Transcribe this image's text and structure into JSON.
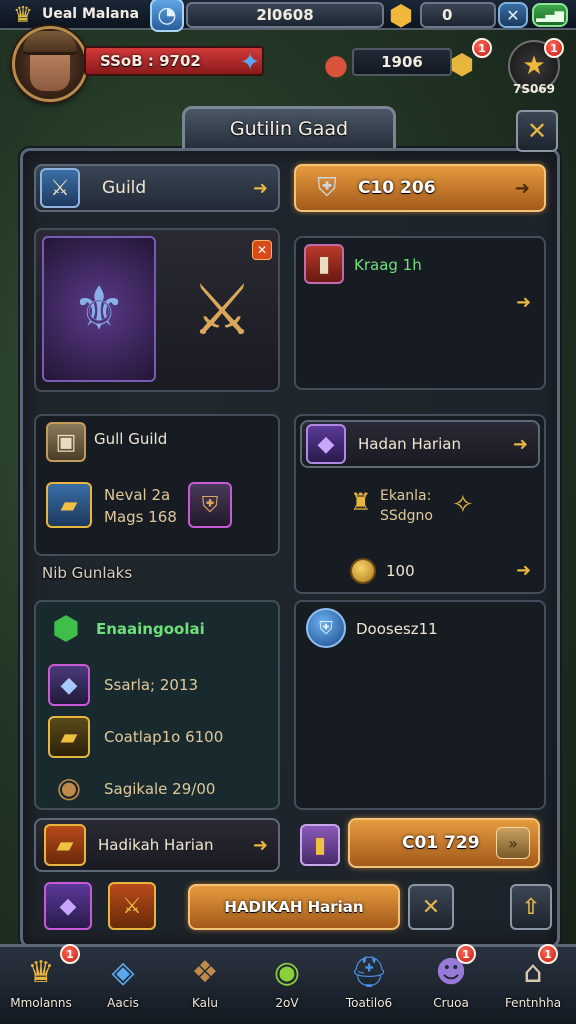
{
  "top_bar": {
    "player_label": "Ueal Malana",
    "currency_main": "2l0608",
    "currency_secondary": "0",
    "icons": {
      "crown": "crown-icon",
      "shield": "shield-icon",
      "gold": "gold-gem-icon",
      "swords": "swords-icon",
      "wifi": "signal-icon"
    }
  },
  "header": {
    "hp_text": "SSoB : 9702",
    "resource_value": "1906",
    "star_count": "7S069",
    "notification_badge": "1"
  },
  "panel": {
    "title": "Gutilin Gaad",
    "guild_header": {
      "label": "Guild"
    },
    "gold_header": {
      "label": "C10 206"
    },
    "quest_card": {
      "label": "Kraag 1h"
    },
    "guild_guild": {
      "title": "Gull Guild",
      "reward_line1": "Neval 2a",
      "reward_line2": "Mags 168"
    },
    "daily": {
      "title": "Hadan Harian",
      "reward_line1": "Ekanla:",
      "reward_line2": "SSdgno",
      "coins": "100"
    },
    "section_label": "Nib Gunlaks",
    "goals": {
      "title": "Enaaingoolai",
      "items": [
        {
          "label": "Ssarla; 2013"
        },
        {
          "label": "Coatlap1o 6100"
        },
        {
          "label": "Sagikale 29/00"
        }
      ]
    },
    "doses": {
      "title": "Doosesz11"
    },
    "hadikah": {
      "label": "Hadikah Harian"
    },
    "price_bar": {
      "label": "C01 729"
    },
    "action_button": {
      "label": "HADIKAH Harian"
    }
  },
  "nav": {
    "items": [
      {
        "label": "Mmolanns",
        "badge": "1"
      },
      {
        "label": "Aacis",
        "badge": ""
      },
      {
        "label": "Kalu",
        "badge": ""
      },
      {
        "label": "2oV",
        "badge": ""
      },
      {
        "label": "Toatilo6",
        "badge": ""
      },
      {
        "label": "Cruoa",
        "badge": "1"
      },
      {
        "label": "Fentnhha",
        "badge": "1"
      }
    ]
  },
  "colors": {
    "accent_gold": "#e59b3e",
    "hp_red": "#d23a3a",
    "panel_bg": "#1e242c",
    "green_text": "#6ee07a"
  }
}
